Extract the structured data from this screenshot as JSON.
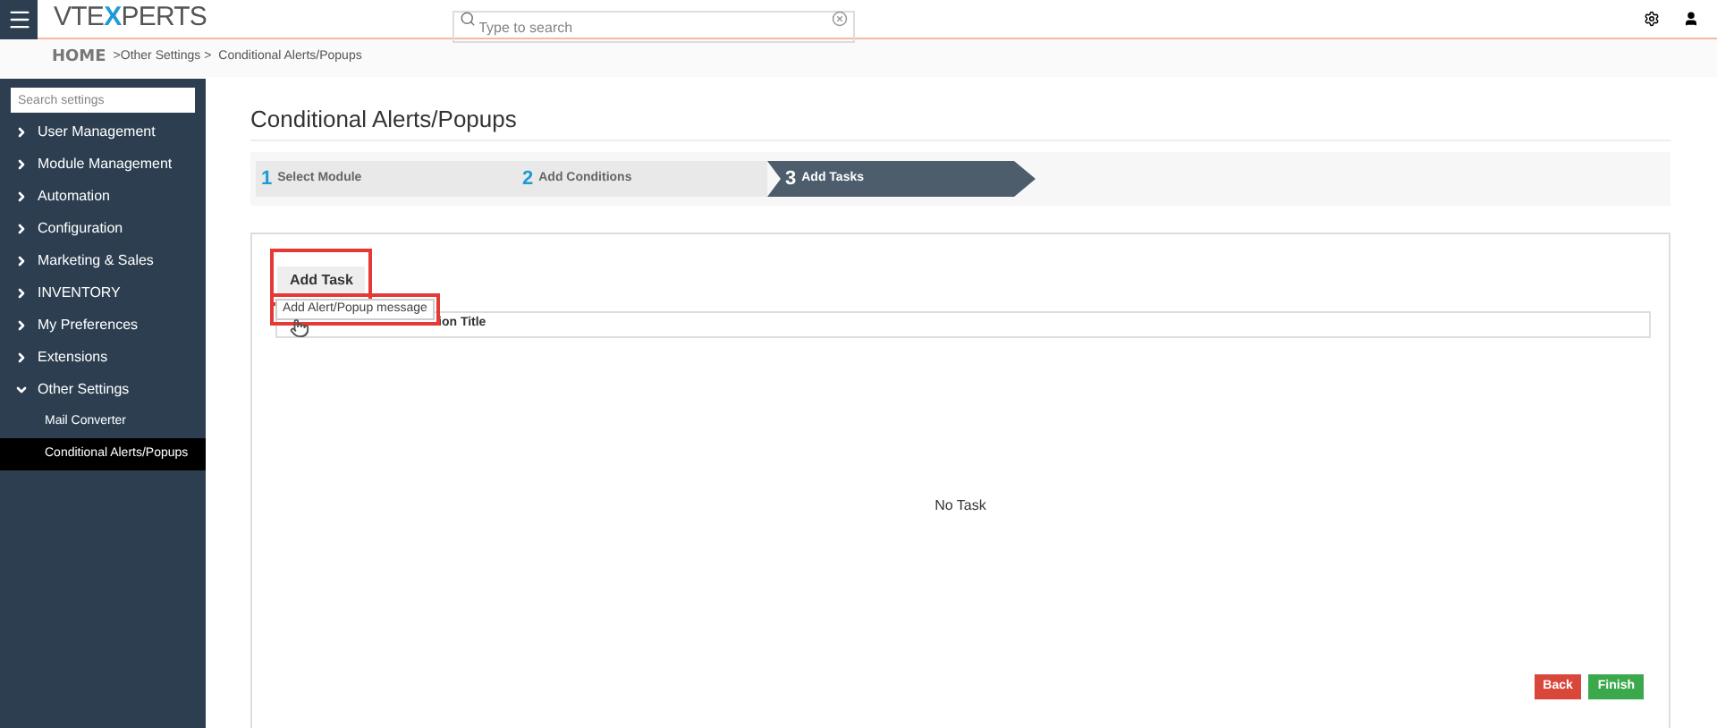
{
  "header": {
    "logo": [
      {
        "text": "VTE",
        "highlight": false
      },
      {
        "text": "X",
        "highlight": true
      },
      {
        "text": "PERTS",
        "highlight": false
      }
    ],
    "search": {
      "placeholder": "Type to search"
    }
  },
  "breadcrumb": {
    "home": "HOME",
    "trail": [
      ">Other Settings >",
      "Conditional Alerts/Popups"
    ]
  },
  "sidebar": {
    "search": {
      "placeholder": "Search settings"
    },
    "items": [
      {
        "label": "User Management",
        "expanded": false
      },
      {
        "label": "Module Management",
        "expanded": false
      },
      {
        "label": "Automation",
        "expanded": false
      },
      {
        "label": "Configuration",
        "expanded": false
      },
      {
        "label": "Marketing & Sales",
        "expanded": false
      },
      {
        "label": "INVENTORY",
        "expanded": false
      },
      {
        "label": "My Preferences",
        "expanded": false
      },
      {
        "label": "Extensions",
        "expanded": false
      },
      {
        "label": "Other Settings",
        "expanded": true,
        "children": [
          {
            "label": "Mail Converter",
            "selected": false
          },
          {
            "label": "Conditional Alerts/Popups",
            "selected": true
          }
        ]
      }
    ]
  },
  "page": {
    "title": "Conditional Alerts/Popups",
    "steps": [
      {
        "number": "1",
        "label": "Select Module",
        "selected": false
      },
      {
        "number": "2",
        "label": "Add Conditions",
        "selected": false
      },
      {
        "number": "3",
        "label": "Add Tasks",
        "selected": true
      }
    ],
    "add_task_button": "Add Task",
    "dropdown_item": "Add Alert/Popup message",
    "column_header": "ion Title",
    "empty": "No Task",
    "buttons": [
      {
        "label": "Back",
        "kind": "danger"
      },
      {
        "label": "Finish",
        "kind": "success"
      }
    ]
  }
}
